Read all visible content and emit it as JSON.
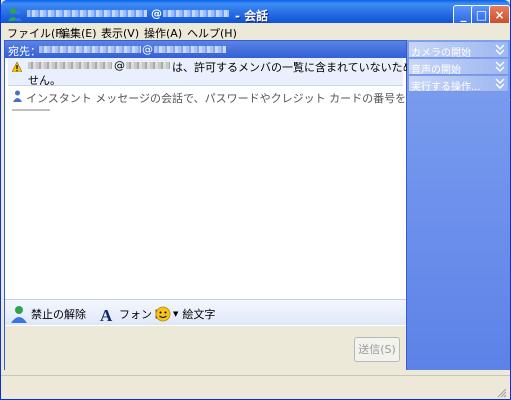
{
  "window": {
    "title": "- 会話",
    "controls": {
      "minimize": "_",
      "maximize": "□",
      "close": "×"
    }
  },
  "menu": [
    {
      "label": "ファイル(F)"
    },
    {
      "label": "編集(E)"
    },
    {
      "label": "表示(V)"
    },
    {
      "label": "操作(A)"
    },
    {
      "label": "ヘルプ(H)"
    }
  ],
  "header": {
    "to_label": "宛先：",
    "at": "@"
  },
  "messages": {
    "warning_line1": "は、許可するメンバの一覧に含まれていないため、返信できま",
    "warning_line2": "せん。",
    "at": "@",
    "info": "インスタント メッセージの会話で、パスワードやクレジット カードの番号を公開しないでください。"
  },
  "toolbar": {
    "unblock": "禁止の解除",
    "font": "フォント",
    "emoticons": "絵文字"
  },
  "compose": {
    "send": "送信(S)"
  },
  "tasks": [
    {
      "label": "カメラの開始"
    },
    {
      "label": "音声の開始"
    },
    {
      "label": "実行する操作..."
    }
  ],
  "colors": {
    "title_bar": "#0a4fd4",
    "task_pane": "#6a8eea",
    "accent": "#3360d6"
  }
}
